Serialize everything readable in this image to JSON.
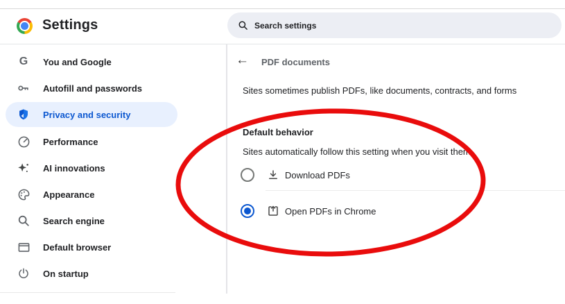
{
  "header": {
    "title": "Settings",
    "search_placeholder": "Search settings",
    "logo_icon": "chrome-logo-icon",
    "search_icon": "search-icon"
  },
  "sidebar": {
    "items": [
      {
        "label": "You and Google",
        "icon": "google-g-icon",
        "selected": false
      },
      {
        "label": "Autofill and passwords",
        "icon": "key-icon",
        "selected": false
      },
      {
        "label": "Privacy and security",
        "icon": "shield-icon",
        "selected": true
      },
      {
        "label": "Performance",
        "icon": "speedometer-icon",
        "selected": false
      },
      {
        "label": "AI innovations",
        "icon": "sparkle-icon",
        "selected": false
      },
      {
        "label": "Appearance",
        "icon": "palette-icon",
        "selected": false
      },
      {
        "label": "Search engine",
        "icon": "magnifier-icon",
        "selected": false
      },
      {
        "label": "Default browser",
        "icon": "browser-icon",
        "selected": false
      },
      {
        "label": "On startup",
        "icon": "power-icon",
        "selected": false
      }
    ]
  },
  "main": {
    "back_icon": "back-arrow-icon",
    "page_title": "PDF documents",
    "description": "Sites sometimes publish PDFs, like documents, contracts, and forms",
    "section": {
      "title": "Default behavior",
      "subtitle": "Sites automatically follow this setting when you visit them",
      "options": [
        {
          "label": "Download PDFs",
          "icon": "download-icon",
          "selected": false
        },
        {
          "label": "Open PDFs in Chrome",
          "icon": "open-in-chrome-icon",
          "selected": true
        }
      ]
    }
  },
  "annotation": {
    "shape": "ellipse",
    "purpose": "highlights Default behavior radio group",
    "color": "#e90c0c"
  },
  "colors": {
    "accent_blue": "#0b57d0",
    "selected_pill_bg": "#e8f0fe",
    "search_bg": "#eceef4",
    "divider": "#e4e4e8",
    "text_primary": "#202124",
    "text_secondary": "#5f6368"
  }
}
